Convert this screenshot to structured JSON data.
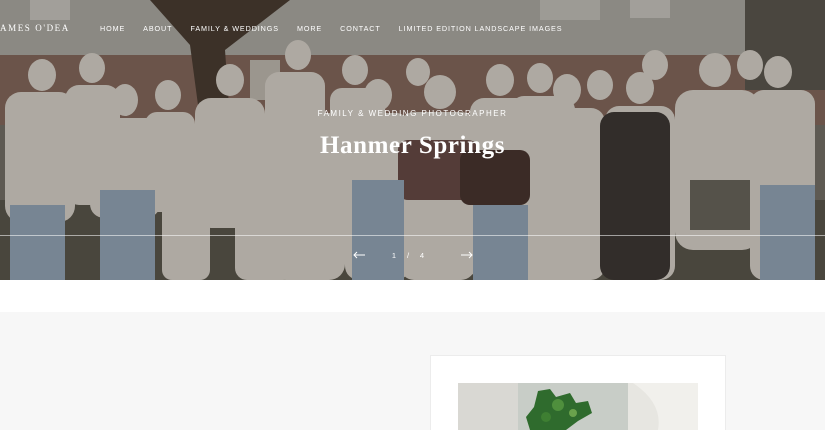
{
  "brand": {
    "name": "AMES O'DEA"
  },
  "nav": {
    "items": [
      {
        "label": "HOME"
      },
      {
        "label": "ABOUT"
      },
      {
        "label": "FAMILY & WEDDINGS"
      },
      {
        "label": "MORE"
      },
      {
        "label": "CONTACT"
      },
      {
        "label": "LIMITED EDITION LANDSCAPE IMAGES"
      }
    ]
  },
  "hero": {
    "subtitle": "FAMILY & WEDDING PHOTOGRAPHER",
    "title": "Hanmer Springs",
    "pager": {
      "current": "1",
      "separator": "/",
      "total": "4"
    }
  },
  "colors": {
    "text_on_image": "#ffffff",
    "section_bg": "#f7f7f7",
    "card_bg": "#ffffff"
  }
}
